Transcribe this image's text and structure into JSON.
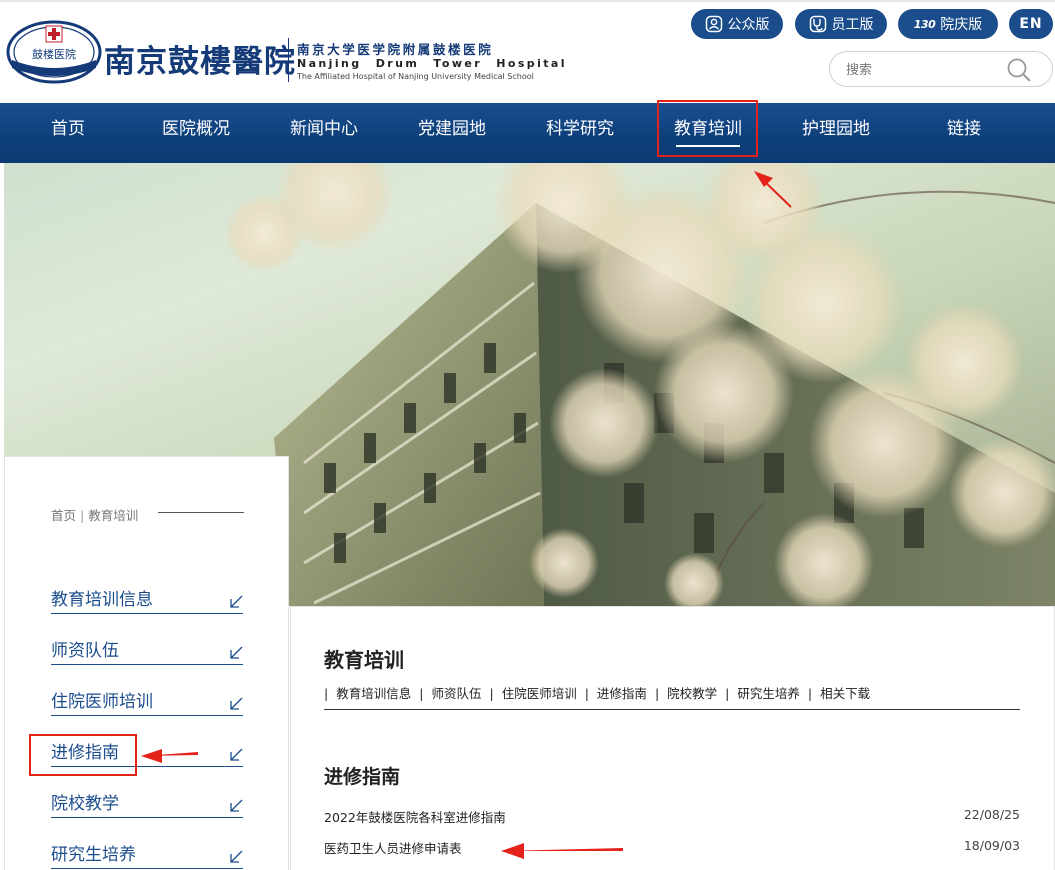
{
  "header": {
    "logo_seal_text": "鼓楼医院",
    "logo_name": "南京鼓樓醫院",
    "logo_cn": "南京大学医学院附属鼓楼医院",
    "logo_en_line1": "Nanjing Drum Tower Hospital",
    "logo_en_line2": "The Affiliated Hospital of Nanjing University Medical School",
    "buttons": {
      "public": "公众版",
      "staff": "员工版",
      "anniversary": "院庆版",
      "anniversary_badge": "130",
      "english": "EN"
    },
    "search": {
      "placeholder": "搜索",
      "value": ""
    }
  },
  "nav": {
    "items": [
      {
        "label": "首页"
      },
      {
        "label": "医院概况"
      },
      {
        "label": "新闻中心"
      },
      {
        "label": "党建园地"
      },
      {
        "label": "科学研究"
      },
      {
        "label": "教育培训",
        "active": true
      },
      {
        "label": "护理园地"
      },
      {
        "label": "链接"
      }
    ]
  },
  "sidebar": {
    "breadcrumb": {
      "home": "首页",
      "separator": "|",
      "current": "教育培训"
    },
    "items": [
      {
        "label": "教育培训信息"
      },
      {
        "label": "师资队伍"
      },
      {
        "label": "住院医师培训"
      },
      {
        "label": "进修指南",
        "highlighted": true
      },
      {
        "label": "院校教学"
      },
      {
        "label": "研究生培养"
      }
    ]
  },
  "content": {
    "section_title": "教育培训",
    "subnav": [
      "教育培训信息",
      "师资队伍",
      "住院医师培训",
      "进修指南",
      "院校教学",
      "研究生培养",
      "相关下载"
    ],
    "page_title": "进修指南",
    "articles": [
      {
        "title": "2022年鼓楼医院各科室进修指南",
        "date": "22/08/25"
      },
      {
        "title": "医药卫生人员进修申请表",
        "date": "18/09/03"
      }
    ]
  },
  "colors": {
    "brand_blue": "#1b4d8c",
    "nav_bg": "#0d3f7a",
    "highlight_red": "#e3231a"
  }
}
